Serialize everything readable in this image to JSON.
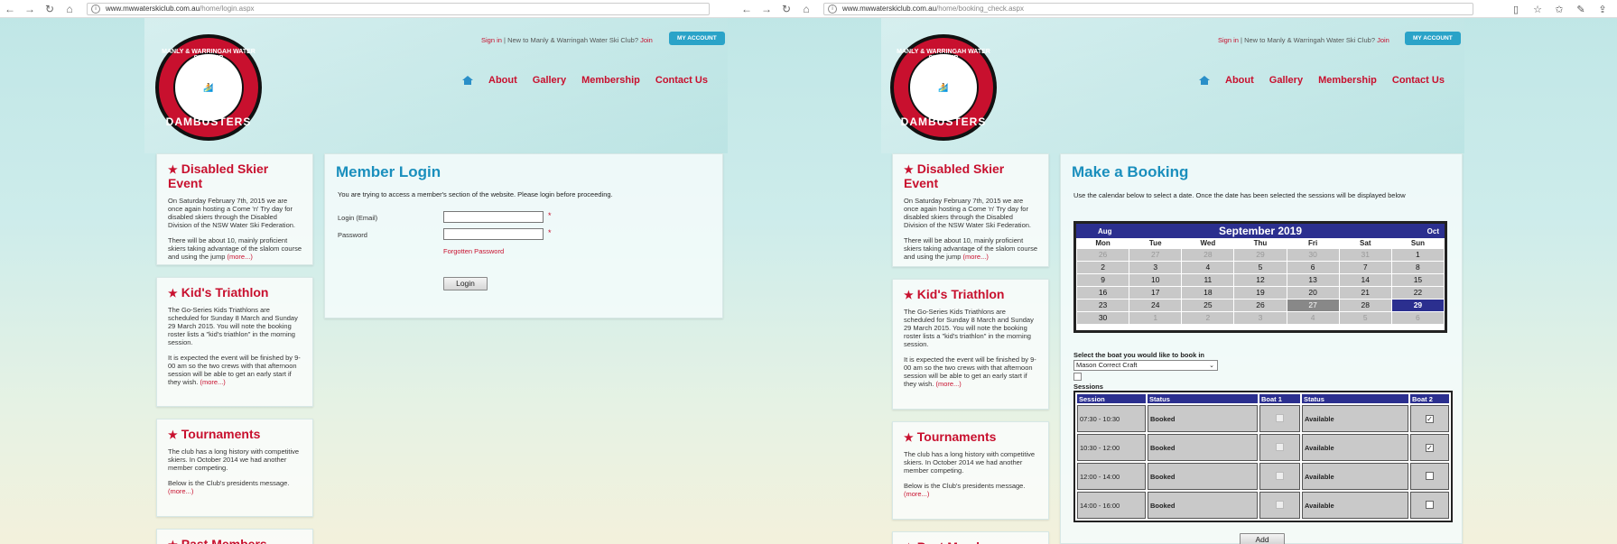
{
  "left": {
    "url_host": "www.mwwaterskiclub.com.au",
    "url_path": "/home/login.aspx"
  },
  "right": {
    "url_host": "www.mwwaterskiclub.com.au",
    "url_path": "/home/booking_check.aspx"
  },
  "header": {
    "sign_in": "Sign in",
    "sep": "|",
    "new_text": "New to Manly & Warringah Water Ski Club?",
    "join": "Join",
    "my_account": "MY ACCOUNT",
    "logo_top": "MANLY & WARRINGAH WATER SKI CLUB",
    "logo_bottom": "DAMBUSTERS",
    "menu": [
      "About",
      "Gallery",
      "Membership",
      "Contact Us"
    ]
  },
  "sidebar": {
    "disabled": {
      "title": "Disabled Skier Event",
      "p1": "On Saturday February 7th, 2015 we are once again hosting a Come 'n' Try day for disabled skiers through the Disabled Division of the NSW Water Ski Federation.",
      "p2": "There will be about 10, mainly proficient skiers taking advantage of the slalom course and using the jump",
      "more": "(more...)"
    },
    "triathlon": {
      "title": "Kid's Triathlon",
      "p1": "The Go-Series Kids Triathlons are scheduled for Sunday 8 March and Sunday 29 March 2015. You will note the booking roster lists a \"kid's triathlon\" in the morning session.",
      "p2": "It is expected the event will be finished by 9-00 am so the two crews with that afternoon session will be able to get an early start if they wish.",
      "more": "(more...)"
    },
    "tournaments": {
      "title": "Tournaments",
      "p1": "The club has a long history with competitive skiers. In October 2014 we had another member competing.",
      "p2": "Below is the Club's presidents message.",
      "more": "(more...)"
    },
    "past": {
      "title": "Past Members"
    }
  },
  "login": {
    "title": "Member Login",
    "intro": "You are trying to access a member's section of the website. Please login before proceeding.",
    "email_label": "Login (Email)",
    "password_label": "Password",
    "required": "*",
    "forgot": "Forgotten Password",
    "login_btn": "Login"
  },
  "booking": {
    "title": "Make a Booking",
    "intro": "Use the calendar below to select a date. Once the date has been selected the sessions will be displayed below",
    "calendar": {
      "month": "September 2019",
      "prev": "Aug",
      "next": "Oct",
      "days": [
        "Mon",
        "Tue",
        "Wed",
        "Thu",
        "Fri",
        "Sat",
        "Sun"
      ],
      "weeks": [
        [
          "26",
          "27",
          "28",
          "29",
          "30",
          "31",
          "1"
        ],
        [
          "2",
          "3",
          "4",
          "5",
          "6",
          "7",
          "8"
        ],
        [
          "9",
          "10",
          "11",
          "12",
          "13",
          "14",
          "15"
        ],
        [
          "16",
          "17",
          "18",
          "19",
          "20",
          "21",
          "22"
        ],
        [
          "23",
          "24",
          "25",
          "26",
          "27",
          "28",
          "29"
        ],
        [
          "30",
          "1",
          "2",
          "3",
          "4",
          "5",
          "6"
        ]
      ]
    },
    "boat_label": "Select the boat you would like to book in",
    "boat_value": "Mason Correct Craft",
    "sessions_label": "Sessions",
    "headers": [
      "Session",
      "Status",
      "Boat 1",
      "Status",
      "Boat 2"
    ],
    "rows": [
      {
        "session": "07:30 - 10:30",
        "status1": "Booked",
        "status2": "Available",
        "boat2_checked": true
      },
      {
        "session": "10:30 - 12:00",
        "status1": "Booked",
        "status2": "Available",
        "boat2_checked": true
      },
      {
        "session": "12:00 - 14:00",
        "status1": "Booked",
        "status2": "Available",
        "boat2_checked": false
      },
      {
        "session": "14:00 - 16:00",
        "status1": "Booked",
        "status2": "Available",
        "boat2_checked": false
      }
    ],
    "add_btn": "Add"
  }
}
